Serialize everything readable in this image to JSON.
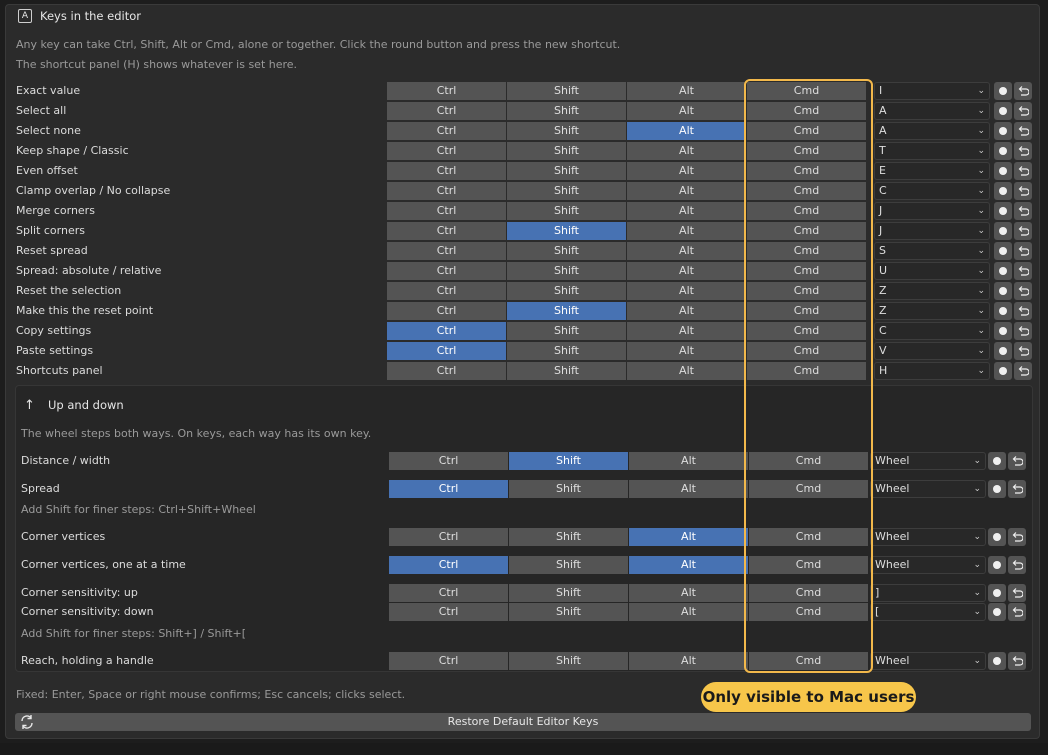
{
  "header": {
    "icon_letter": "A",
    "title": "Keys in the editor"
  },
  "description": [
    "Any key can take Ctrl, Shift, Alt or Cmd, alone or together. Click the round button and press the new shortcut.",
    "The shortcut panel (H) shows whatever is set here."
  ],
  "modifiers": [
    "Ctrl",
    "Shift",
    "Alt",
    "Cmd"
  ],
  "rows": [
    {
      "label": "Exact value",
      "key": "I",
      "active": []
    },
    {
      "label": "Select all",
      "key": "A",
      "active": []
    },
    {
      "label": "Select none",
      "key": "A",
      "active": [
        "Alt"
      ]
    },
    {
      "label": "Keep shape / Classic",
      "key": "T",
      "active": []
    },
    {
      "label": "Even offset",
      "key": "E",
      "active": []
    },
    {
      "label": "Clamp overlap / No collapse",
      "key": "C",
      "active": []
    },
    {
      "label": "Merge corners",
      "key": "J",
      "active": []
    },
    {
      "label": "Split corners",
      "key": "J",
      "active": [
        "Shift"
      ]
    },
    {
      "label": "Reset spread",
      "key": "S",
      "active": []
    },
    {
      "label": "Spread: absolute / relative",
      "key": "U",
      "active": []
    },
    {
      "label": "Reset the selection",
      "key": "Z",
      "active": []
    },
    {
      "label": "Make this the reset point",
      "key": "Z",
      "active": [
        "Shift"
      ]
    },
    {
      "label": "Copy settings",
      "key": "C",
      "active": [
        "Ctrl"
      ]
    },
    {
      "label": "Paste settings",
      "key": "V",
      "active": [
        "Ctrl"
      ]
    },
    {
      "label": "Shortcuts panel",
      "key": "H",
      "active": []
    }
  ],
  "updown": {
    "title": "Up and down",
    "description": "The wheel steps both ways. On keys, each way has its own key.",
    "rows": [
      {
        "label": "Distance / width",
        "key": "Wheel",
        "active": [
          "Shift"
        ]
      },
      {
        "label": "Spread",
        "key": "Wheel",
        "active": [
          "Ctrl"
        ]
      },
      {
        "label": "Corner vertices",
        "key": "Wheel",
        "active": [
          "Alt"
        ]
      },
      {
        "label": "Corner vertices, one at a time",
        "key": "Wheel",
        "active": [
          "Ctrl",
          "Alt"
        ]
      },
      {
        "label": "Corner sensitivity: up",
        "key": "]",
        "active": []
      },
      {
        "label": "Corner sensitivity: down",
        "key": "[",
        "active": []
      },
      {
        "label": "Reach, holding a handle",
        "key": "Wheel",
        "active": []
      }
    ],
    "notes": [
      "Add Shift for finer steps: Ctrl+Shift+Wheel",
      "Add Shift for finer steps: Shift+] / Shift+["
    ]
  },
  "footer_note": "Fixed: Enter, Space or right mouse confirms; Esc cancels; clicks select.",
  "restore_label": "Restore Default Editor Keys",
  "callout": "Only visible to Mac users",
  "colors": {
    "active": "#4772b3",
    "button": "#545454",
    "highlight": "#f2b84b"
  },
  "icons": {
    "header": "letter-a-icon",
    "updown": "arrow-up-icon",
    "reset": "undo-arrow-icon",
    "record": "record-dot-icon",
    "restore": "refresh-icon",
    "dropdown": "chevron-down-icon"
  }
}
